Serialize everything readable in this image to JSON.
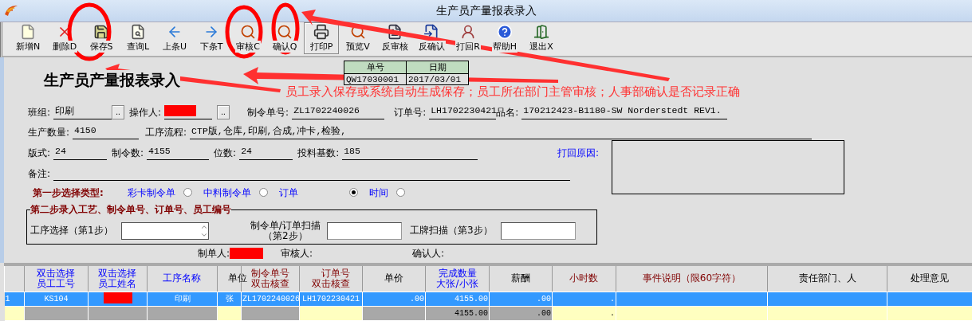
{
  "window": {
    "title": "生产员产量报表录入"
  },
  "toolbar": [
    {
      "label": "新增N",
      "raised": false
    },
    {
      "label": "删除D",
      "raised": false
    },
    {
      "label": "保存S",
      "raised": false
    },
    {
      "label": "查询L",
      "raised": false
    },
    {
      "label": "上条U",
      "raised": false
    },
    {
      "label": "下条T",
      "raised": false
    },
    {
      "label": "审核C",
      "raised": false
    },
    {
      "label": "确认Q",
      "raised": false
    },
    {
      "label": "打印P",
      "raised": true
    },
    {
      "label": "预览V",
      "raised": false
    },
    {
      "label": "反审核",
      "raised": false
    },
    {
      "label": "反确认",
      "raised": false
    },
    {
      "label": "打回R",
      "raised": false
    },
    {
      "label": "帮助H",
      "raised": false
    },
    {
      "label": "退出X",
      "raised": false
    }
  ],
  "form_title": "生产员产量报表录入",
  "document": {
    "headers": [
      "单号",
      "日期"
    ],
    "values": [
      "QW17030001",
      "2017/03/01"
    ]
  },
  "annotation": {
    "text": "员工录入保存或系统自动生成保存；员工所在部门主管审核；人事部确认是否记录正确"
  },
  "row_1": [
    {
      "kind": "lookup",
      "label": "班组:",
      "value": "印刷",
      "button": ".."
    },
    {
      "kind": "redacted-lookup",
      "label": "操作人:",
      "button": ".."
    },
    {
      "kind": "text",
      "label": "制令单号:",
      "value": "ZL1702240026"
    },
    {
      "kind": "text",
      "label": "订单号:",
      "value": "LH1702230421"
    },
    {
      "kind": "text",
      "label": "品名:",
      "value": "170212423-B1180-SW Norderstedt REV1."
    }
  ],
  "row_2": [
    {
      "kind": "text",
      "label": "生产数量:",
      "value": "4150"
    },
    {
      "kind": "text",
      "label": "工序流程:",
      "value": "CTP版,仓库,印刷,合成,冲卡,检验,"
    }
  ],
  "row_3": [
    {
      "kind": "text",
      "label": "版式:",
      "value": "24"
    },
    {
      "kind": "text",
      "label": "制令数:",
      "value": "4155"
    },
    {
      "kind": "text",
      "label": "位数:",
      "value": "24"
    },
    {
      "kind": "text",
      "label": "投料基数:",
      "value": "185"
    }
  ],
  "remark": {
    "label": "备注:"
  },
  "reject_reason": {
    "label": "打回原因:"
  },
  "step_1": {
    "label": "第一步选择类型:",
    "options": [
      {
        "label": "彩卡制令单",
        "selected": false
      },
      {
        "label": "中料制令单",
        "selected": false
      },
      {
        "label": "订单",
        "selected": true
      },
      {
        "label": "时间",
        "selected": false
      }
    ]
  },
  "step_2": {
    "legend": "第二步录入工艺、制令单号、订单号、员工编号",
    "process_label": "工序选择（第1步）",
    "order_label": "制令单/订单扫描（第2步）",
    "badge_label": "工牌扫描（第3步）"
  },
  "signatures": [
    {
      "kind": "redacted",
      "label": "制单人:"
    },
    {
      "kind": "empty",
      "label": "审核人:"
    },
    {
      "kind": "empty",
      "label": "确认人:"
    }
  ],
  "table": {
    "columns": [
      {
        "shaded": false
      },
      {
        "label": "双击选择员工工号",
        "kind": "picker",
        "shaded": true
      },
      {
        "label": "双击选择员工姓名",
        "kind": "picker",
        "shaded": true
      },
      {
        "label": "工序名称",
        "kind": "picker",
        "shaded": true
      },
      {
        "label": "单位",
        "kind": "plain",
        "shaded": false
      },
      {
        "label": "制令单号双击核查",
        "kind": "required",
        "shaded": true
      },
      {
        "label": "订单号双击核查",
        "kind": "required",
        "shaded": false
      },
      {
        "label": "单价",
        "kind": "plain",
        "shaded": true
      },
      {
        "label": "完成数量大张/小张",
        "kind": "picker",
        "shaded": true
      },
      {
        "label": "薪酬",
        "kind": "plain",
        "shaded": true
      },
      {
        "label": "小时数",
        "kind": "required",
        "shaded": false
      },
      {
        "label": "事件说明（限60字符）",
        "kind": "required",
        "shaded": false
      },
      {
        "label": "责任部门、人",
        "kind": "plain",
        "shaded": false
      },
      {
        "label": "处理意见",
        "kind": "plain",
        "shaded": false
      }
    ],
    "rows": [
      {
        "selected": true,
        "cells": [
          "1",
          "KS104",
          {
            "kind": "redacted"
          },
          "印刷",
          "张",
          "ZL1702240026",
          "LH1702230421",
          ".00",
          "4155.00",
          ".00",
          ".",
          null,
          null,
          null
        ]
      },
      {
        "selected": false,
        "cells": [
          null,
          null,
          null,
          null,
          null,
          null,
          null,
          null,
          "4155.00",
          ".00",
          ".",
          null,
          null,
          null
        ]
      }
    ]
  }
}
